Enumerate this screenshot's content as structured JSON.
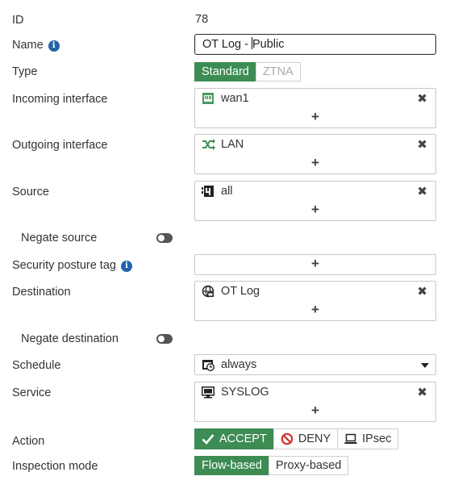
{
  "fields": {
    "id": {
      "label": "ID",
      "value": "78"
    },
    "name": {
      "label": "Name",
      "value_before_caret": "OT Log - ",
      "value_after_caret": "Public",
      "info_icon": "info-icon"
    },
    "type": {
      "label": "Type",
      "options": [
        "Standard",
        "ZTNA"
      ],
      "selected": "Standard"
    },
    "incoming_interface": {
      "label": "Incoming interface",
      "entries": [
        {
          "icon": "port-icon",
          "text": "wan1"
        }
      ],
      "add_symbol": "+",
      "remove_symbol": "✖"
    },
    "outgoing_interface": {
      "label": "Outgoing interface",
      "entries": [
        {
          "icon": "shuffle-icon",
          "text": "LAN"
        }
      ],
      "add_symbol": "+",
      "remove_symbol": "✖"
    },
    "source": {
      "label": "Source",
      "entries": [
        {
          "icon": "address-group-icon",
          "text": "all"
        }
      ],
      "add_symbol": "+",
      "remove_symbol": "✖"
    },
    "negate_source": {
      "label": "Negate source",
      "enabled": false
    },
    "security_posture_tag": {
      "label": "Security posture tag",
      "add_symbol": "+",
      "info_icon": "info-icon"
    },
    "destination": {
      "label": "Destination",
      "entries": [
        {
          "icon": "globe-network-icon",
          "text": "OT Log"
        }
      ],
      "add_symbol": "+",
      "remove_symbol": "✖"
    },
    "negate_destination": {
      "label": "Negate destination",
      "enabled": false
    },
    "schedule": {
      "label": "Schedule",
      "value": "always"
    },
    "service": {
      "label": "Service",
      "entries": [
        {
          "icon": "monitor-service-icon",
          "text": "SYSLOG"
        }
      ],
      "add_symbol": "+",
      "remove_symbol": "✖"
    },
    "action": {
      "label": "Action",
      "options": [
        "ACCEPT",
        "DENY",
        "IPsec"
      ],
      "selected": "ACCEPT"
    },
    "inspection_mode": {
      "label": "Inspection mode",
      "options": [
        "Flow-based",
        "Proxy-based"
      ],
      "selected": "Flow-based"
    }
  },
  "colors": {
    "selected_green": "#3d8c54",
    "info_blue": "#2563a8",
    "deny_red": "#d22f2f"
  }
}
